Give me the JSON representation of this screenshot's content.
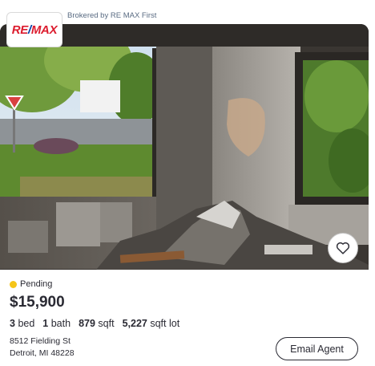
{
  "broker": {
    "logo_text_left": "RE",
    "logo_text_slash": "/",
    "logo_text_right": "MAX",
    "brokered_by": "Brokered by RE MAX First"
  },
  "listing": {
    "status": "Pending",
    "status_color": "#f5c518",
    "price": "$15,900",
    "beds_value": "3",
    "beds_unit": "bed",
    "baths_value": "1",
    "baths_unit": "bath",
    "sqft_value": "879",
    "sqft_unit": "sqft",
    "lot_value": "5,227",
    "lot_unit": "sqft lot",
    "address_line1": "8512 Fielding St",
    "address_line2": "Detroit, MI 48228"
  },
  "actions": {
    "email_agent": "Email Agent",
    "favorite_icon": "heart-icon"
  },
  "colors": {
    "remax_red": "#dc1c2e",
    "remax_blue": "#003da5"
  }
}
